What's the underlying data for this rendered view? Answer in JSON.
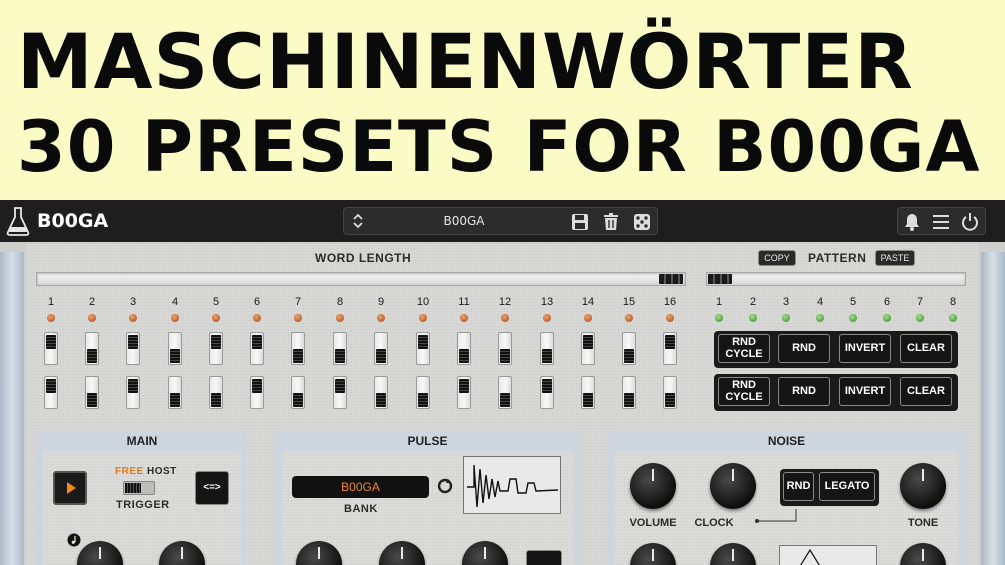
{
  "banner": {
    "line1": "MASCHINENWÖRTER",
    "line2": "30 PRESETS FOR B00GA"
  },
  "topbar": {
    "app_name": "B00GA",
    "preset_name": "B00GA",
    "icons": [
      "flask-logo-icon",
      "preset-arrows-icon",
      "save-icon",
      "trash-icon",
      "dice-icon",
      "bell-icon",
      "menu-icon",
      "power-icon"
    ]
  },
  "word_length": {
    "label": "WORD LENGTH",
    "steps": [
      "1",
      "2",
      "3",
      "4",
      "5",
      "6",
      "7",
      "8",
      "9",
      "10",
      "11",
      "12",
      "13",
      "14",
      "15",
      "16"
    ]
  },
  "pattern": {
    "label": "PATTERN",
    "copy_label": "COPY",
    "paste_label": "PASTE",
    "steps": [
      "1",
      "2",
      "3",
      "4",
      "5",
      "6",
      "7",
      "8"
    ],
    "row1": [
      "RND CYCLE",
      "RND",
      "INVERT",
      "CLEAR"
    ],
    "row2": [
      "RND CYCLE",
      "RND",
      "INVERT",
      "CLEAR"
    ]
  },
  "main": {
    "title": "MAIN",
    "free_label": "FREE",
    "host_label": "HOST",
    "trigger_label": "TRIGGER",
    "swap_label": "<=>"
  },
  "pulse": {
    "title": "PULSE",
    "bank_value": "B00GA",
    "bank_label": "BANK"
  },
  "noise": {
    "title": "NOISE",
    "volume_label": "VOLUME",
    "clock_label": "CLOCK",
    "tone_label": "TONE",
    "rnd_label": "RND",
    "legato_label": "LEGATO"
  },
  "colors": {
    "banner_bg": "#fbfbc6",
    "accent_orange": "#f08a1c",
    "led_orange": "#d9692c",
    "led_green": "#5cbb44"
  }
}
